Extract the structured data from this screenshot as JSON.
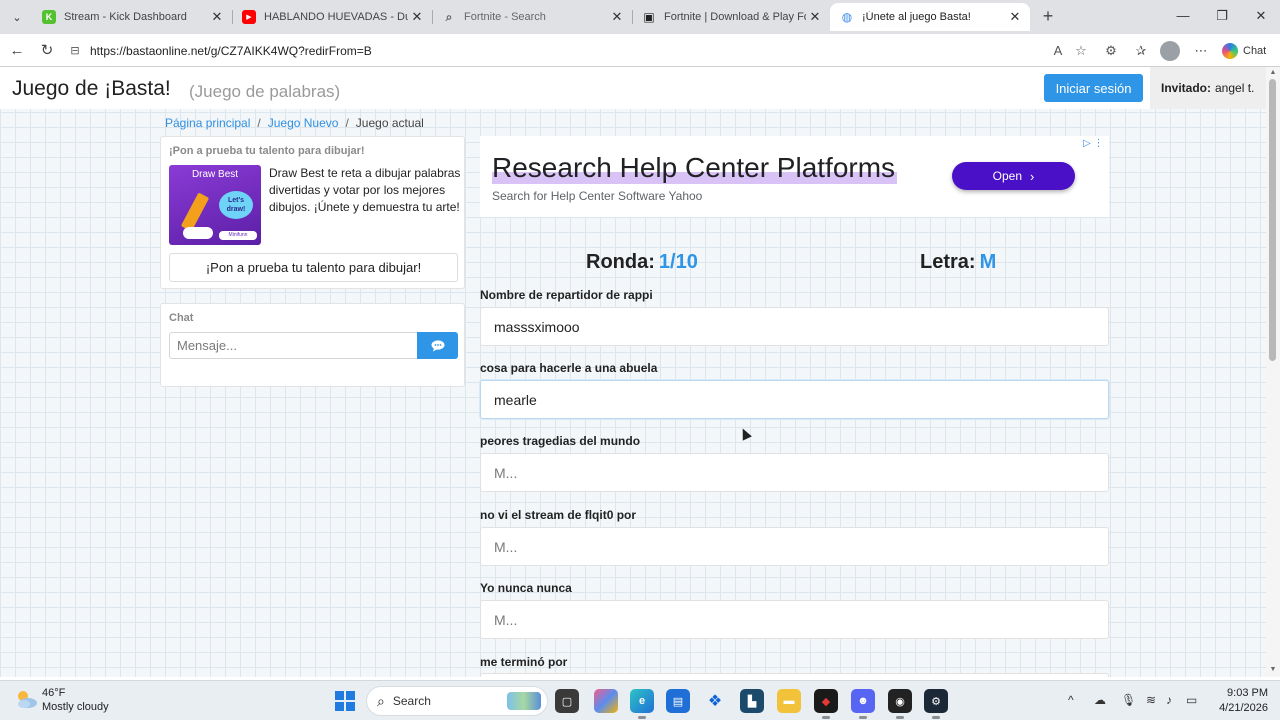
{
  "browser": {
    "tabs": [
      {
        "title": "Stream - Kick Dashboard",
        "fav_color": "#53c130",
        "fav_glyph": "K"
      },
      {
        "title": "HABLANDO HUEVADAS - Duodéc",
        "fav_color": "#ff0000",
        "fav_glyph": "▶"
      },
      {
        "title": "Fortnite - Search",
        "fav_color": "#9aa0a6",
        "fav_glyph": "⌕"
      },
      {
        "title": "Fortnite | Download & Play For Fre",
        "fav_color": "#222222",
        "fav_glyph": "▣"
      },
      {
        "title": "¡Únete al juego Basta!",
        "fav_color": "#3b8ce6",
        "fav_glyph": "◍"
      }
    ],
    "url": "https://bastaonline.net/g/CZ7AIKK4WQ?redirFrom=B",
    "chat_label": "Chat"
  },
  "site": {
    "title": "Juego de ¡Basta!",
    "subtitle": "(Juego de palabras)",
    "login_label": "Iniciar sesión",
    "guest_label": "Invitado:",
    "guest_name": "angel t."
  },
  "breadcrumb": {
    "home": "Página principal",
    "new_game": "Juego Nuevo",
    "current": "Juego actual"
  },
  "draw_promo": {
    "header": "¡Pon a prueba tu talento para dibujar!",
    "thumb_title": "Draw Best",
    "thumb_bubble": "Let's draw!",
    "thumb_brand": "Minifunn",
    "text": "Draw Best te reta a dibujar palabras divertidas y votar por los mejores dibujos. ¡Únete y demuestra tu arte!",
    "button": "¡Pon a prueba tu talento para dibujar!"
  },
  "chat": {
    "header": "Chat",
    "placeholder": "Mensaje..."
  },
  "ad": {
    "title": "Research Help Center Platforms",
    "subtitle": "Search for Help Center Software Yahoo",
    "button": "Open"
  },
  "game": {
    "round_label": "Ronda:",
    "round_value": "1/10",
    "letter_label": "Letra:",
    "letter_value": "M",
    "fields": [
      {
        "label": "Nombre de repartidor de rappi",
        "value": "masssximooo",
        "placeholder": ""
      },
      {
        "label": "cosa para hacerle a una abuela",
        "value": "mearle",
        "placeholder": ""
      },
      {
        "label": "peores tragedias del mundo",
        "value": "",
        "placeholder": "M..."
      },
      {
        "label": "no vi el stream de flqit0 por",
        "value": "",
        "placeholder": "M..."
      },
      {
        "label": "Yo nunca nunca",
        "value": "",
        "placeholder": "M..."
      },
      {
        "label": "me terminó por",
        "value": "",
        "placeholder": ""
      }
    ]
  },
  "taskbar": {
    "temp": "46°F",
    "condition": "Mostly cloudy",
    "search_label": "Search",
    "time": "9:03 PM",
    "date": "4/21/2026"
  }
}
